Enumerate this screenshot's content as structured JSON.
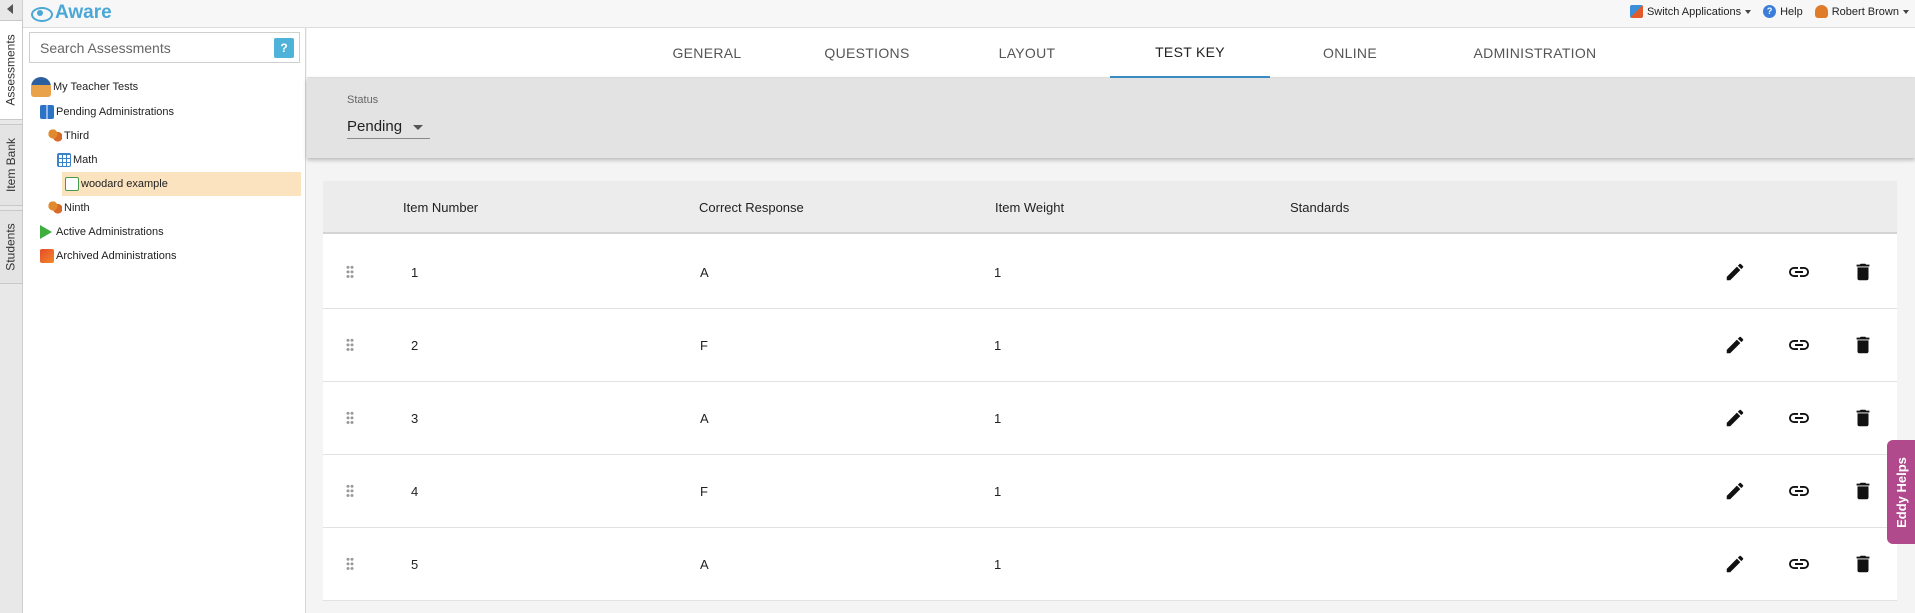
{
  "app": {
    "name": "Aware"
  },
  "side_tabs": [
    {
      "label": "Assessments"
    },
    {
      "label": "Item Bank"
    },
    {
      "label": "Students"
    }
  ],
  "header": {
    "switch_apps": "Switch Applications",
    "help": "Help",
    "user": "Robert Brown"
  },
  "search": {
    "placeholder": "Search Assessments",
    "help_glyph": "?"
  },
  "tree": {
    "root": "My Teacher Tests",
    "pending": "Pending Administrations",
    "third": "Third",
    "math": "Math",
    "woodard": "woodard example",
    "ninth": "Ninth",
    "active": "Active Administrations",
    "archived": "Archived Administrations"
  },
  "tabs": [
    {
      "label": "GENERAL"
    },
    {
      "label": "QUESTIONS"
    },
    {
      "label": "LAYOUT"
    },
    {
      "label": "TEST KEY",
      "active": true
    },
    {
      "label": "ONLINE"
    },
    {
      "label": "ADMINISTRATION"
    }
  ],
  "status": {
    "label": "Status",
    "value": "Pending"
  },
  "table": {
    "headers": {
      "item_number": "Item Number",
      "correct_response": "Correct Response",
      "item_weight": "Item Weight",
      "standards": "Standards"
    },
    "rows": [
      {
        "num": "1",
        "resp": "A",
        "weight": "1"
      },
      {
        "num": "2",
        "resp": "F",
        "weight": "1"
      },
      {
        "num": "3",
        "resp": "A",
        "weight": "1"
      },
      {
        "num": "4",
        "resp": "F",
        "weight": "1"
      },
      {
        "num": "5",
        "resp": "A",
        "weight": "1"
      }
    ]
  },
  "eddy": {
    "label": "Eddy Helps"
  },
  "icons": [
    "edit-icon",
    "link-icon",
    "delete-icon",
    "drag-handle-icon"
  ],
  "colors": {
    "brand": "#4aa7d6",
    "tab_active": "#3b8fc4",
    "selected_node": "#fae3be",
    "eddy": "#b04a8c"
  }
}
